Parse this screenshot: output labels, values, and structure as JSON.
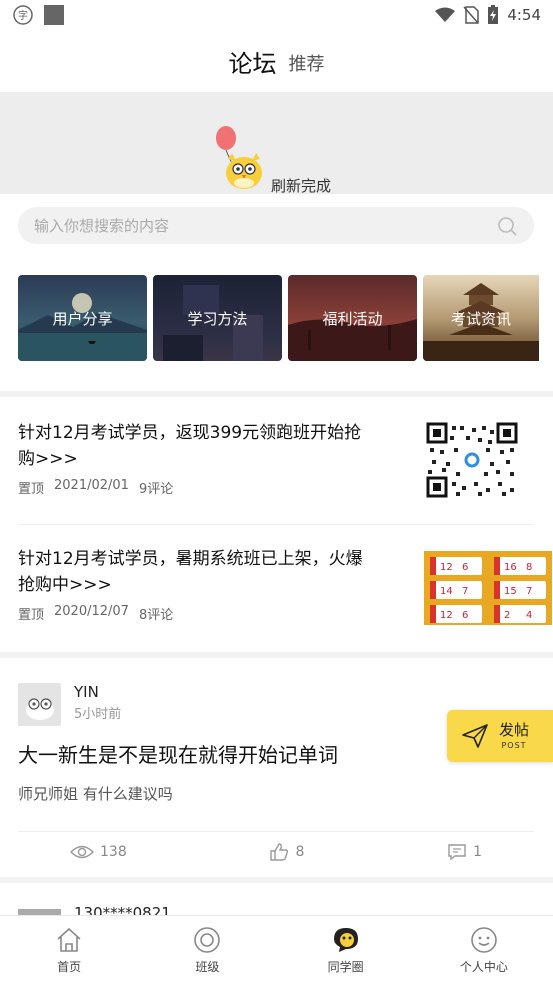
{
  "status_bar": {
    "time": "4:54"
  },
  "tabs": [
    {
      "label": "论坛",
      "active": true
    },
    {
      "label": "推荐",
      "active": false
    }
  ],
  "refresh": {
    "text": "刷新完成"
  },
  "search": {
    "placeholder": "输入你想搜索的内容"
  },
  "categories": [
    {
      "label": "用户分享"
    },
    {
      "label": "学习方法"
    },
    {
      "label": "福利活动"
    },
    {
      "label": "考试资讯"
    }
  ],
  "pinned_posts": [
    {
      "title": "针对12月考试学员，返现399元领跑班开始抢购>>>",
      "tag": "置顶",
      "date": "2021/02/01",
      "comments": "9评论"
    },
    {
      "title": "针对12月考试学员，暑期系统班已上架，火爆抢购中>>>",
      "tag": "置顶",
      "date": "2020/12/07",
      "comments": "8评论"
    }
  ],
  "post": {
    "author": "YIN",
    "time": "5小时前",
    "title": "大一新生是不是现在就得开始记单词",
    "body": "师兄师姐 有什么建议吗",
    "views": "138",
    "likes": "8",
    "comments": "1"
  },
  "next_post": {
    "author": "130****0821"
  },
  "fab": {
    "label": "发帖",
    "sublabel": "POST"
  },
  "bottom_nav": [
    {
      "label": "首页",
      "icon": "home-icon"
    },
    {
      "label": "班级",
      "icon": "class-icon"
    },
    {
      "label": "同学圈",
      "icon": "classmates-icon",
      "active": true
    },
    {
      "label": "个人中心",
      "icon": "profile-icon"
    }
  ],
  "colors": {
    "accent": "#f7c33a",
    "fab": "#f9d949"
  }
}
